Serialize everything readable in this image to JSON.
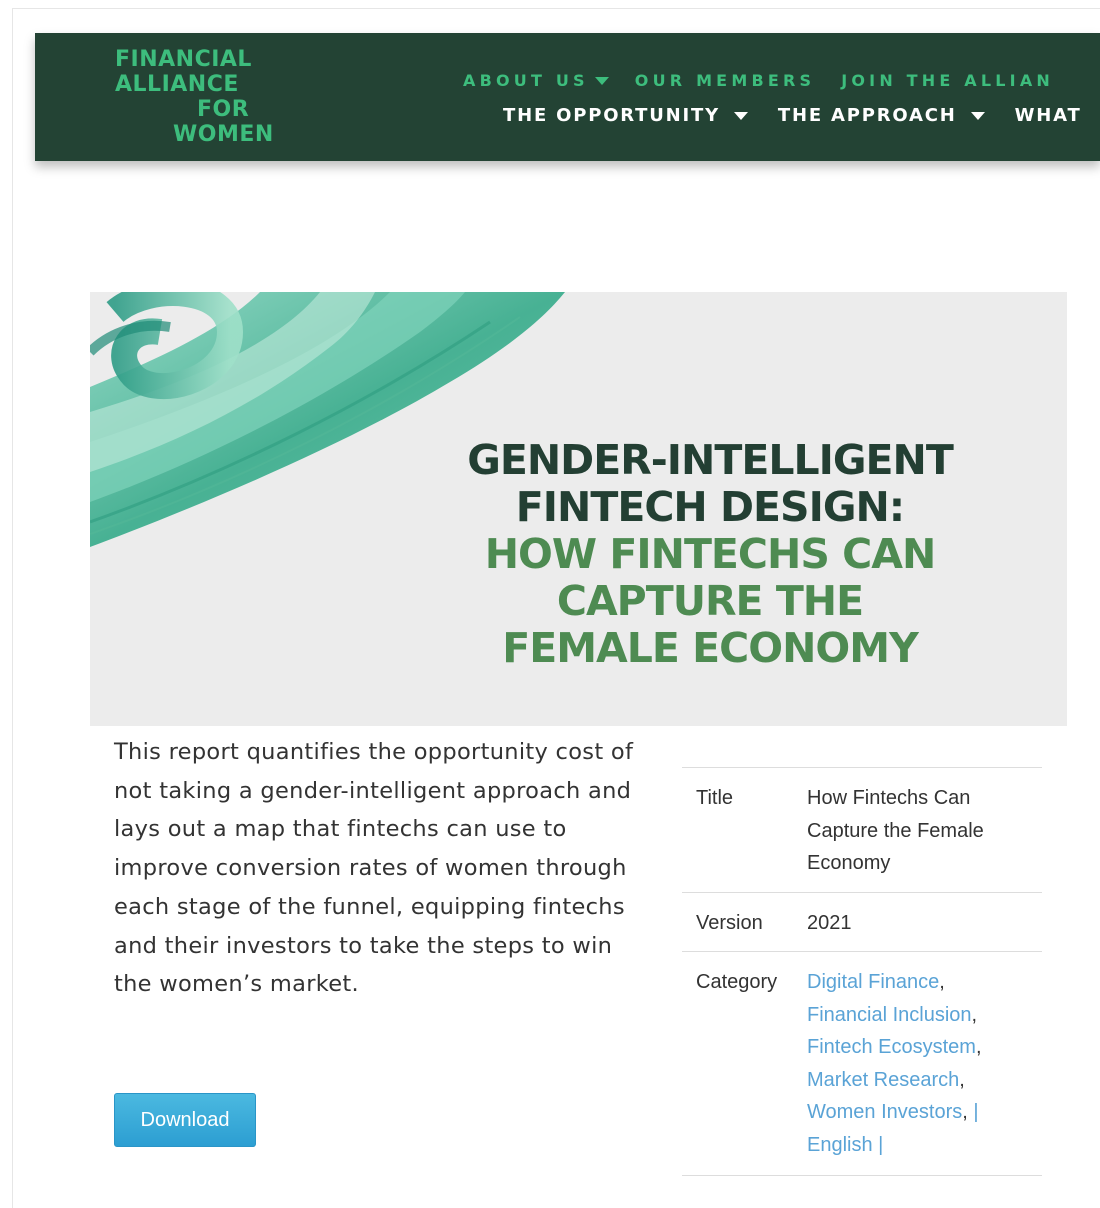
{
  "logo": {
    "line1": "FINANCIAL",
    "line2": "ALLIANCE",
    "line3": "FOR",
    "line4": "WOMEN"
  },
  "nav": {
    "top": [
      {
        "label": "ABOUT US",
        "dropdown": true
      },
      {
        "label": "OUR MEMBERS",
        "dropdown": false
      },
      {
        "label": "JOIN THE ALLIAN",
        "dropdown": false
      }
    ],
    "bottom": [
      {
        "label": "THE OPPORTUNITY",
        "dropdown": true
      },
      {
        "label": "THE APPROACH",
        "dropdown": true
      },
      {
        "label": "WHAT",
        "dropdown": false
      }
    ]
  },
  "hero": {
    "line1": "GENDER-INTELLIGENT",
    "line2": "FINTECH DESIGN:",
    "line3": "HOW FINTECHS CAN",
    "line4": "CAPTURE THE",
    "line5": "FEMALE ECONOMY"
  },
  "description": "This report  quantifies the opportunity cost of not taking a gender-intelligent approach and lays out a map that fintechs can use to improve conversion rates of women through each stage of the funnel, equipping fintechs and their investors to take the steps to win the women’s market.",
  "download_label": "Download",
  "meta": {
    "title_label": "Title",
    "title_value": "How Fintechs Can Capture the Female Economy",
    "version_label": "Version",
    "version_value": "2021",
    "category_label": "Category",
    "categories": [
      "Digital Finance",
      "Financial Inclusion",
      "Fintech Ecosystem",
      "Market Research",
      "Women Investors"
    ],
    "language": "English"
  },
  "colors": {
    "header_bg": "#234334",
    "logo_green": "#3dbd7d",
    "hero_dark": "#233f33",
    "hero_green": "#4e8b52",
    "link_blue": "#5aa3d6",
    "button_blue": "#2c9ed2"
  }
}
